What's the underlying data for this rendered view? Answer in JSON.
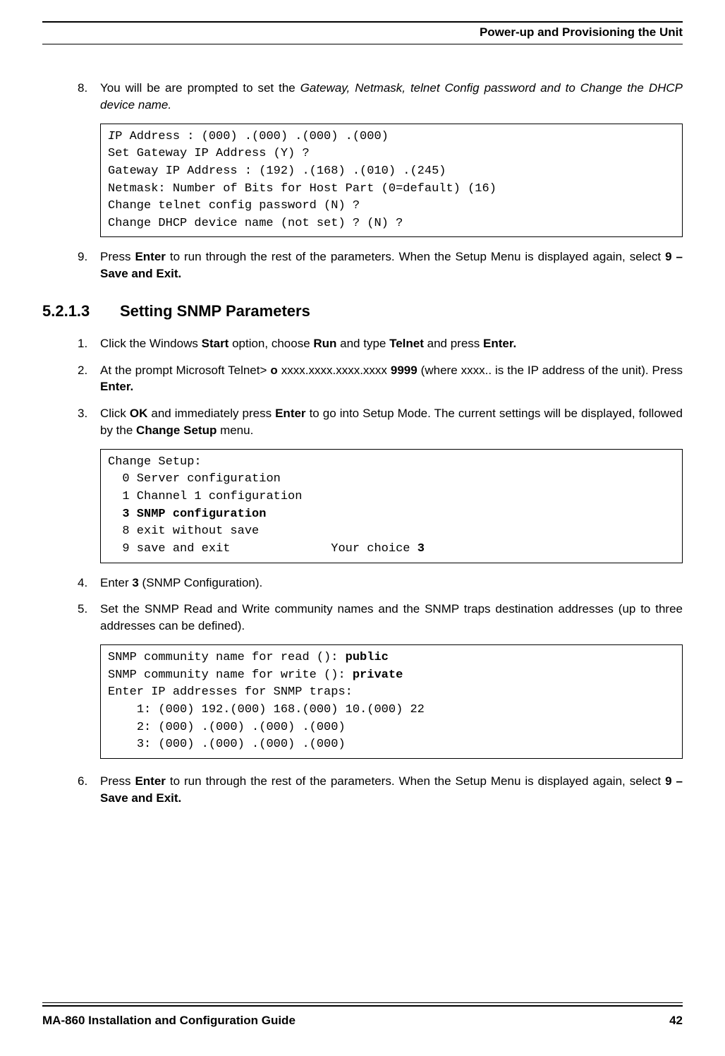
{
  "header": {
    "title": "Power-up and Provisioning the Unit"
  },
  "step8": {
    "num": "8.",
    "prefix": "You will be are prompted to set the ",
    "italic": "Gateway, Netmask, telnet Config password and to Change the DHCP device name.",
    "code": {
      "l1a": "I",
      "l1b": "P Address : (000) .(000) .(000) .(000)",
      "l2": "Set Gateway IP Address (Y) ?",
      "l3": "Gateway IP Address : (192) .(168) .(010) .(245)",
      "l4": "Netmask: Number of Bits for Host Part (0=default) (16)",
      "l5": "Change telnet config password (N) ?",
      "l6": "Change DHCP device name (not set) ? (N) ?"
    }
  },
  "step9": {
    "num": "9.",
    "t1": "Press ",
    "b1": "Enter",
    "t2": " to run through the rest of the parameters. When the Setup Menu is displayed again, select ",
    "b2": "9 – Save and Exit."
  },
  "section": {
    "num": "5.2.1.3",
    "title": "Setting SNMP Parameters"
  },
  "s1": {
    "num": "1.",
    "t1": "Click the Windows ",
    "b1": "Start",
    "t2": " option, choose ",
    "b2": "Run",
    "t3": " and type ",
    "b3": "Telnet",
    "t4": " and press ",
    "b4": "Enter."
  },
  "s2": {
    "num": "2.",
    "t1": "At the prompt Microsoft Telnet> ",
    "b1": "o",
    "t2": " xxxx.xxxx.xxxx.xxxx ",
    "b2": "9999",
    "t3": " (where xxxx.. is the IP address of the unit). Press ",
    "b3": "Enter."
  },
  "s3": {
    "num": "3.",
    "t1": "Click ",
    "b1": "OK",
    "t2": " and immediately press ",
    "b2": "Enter",
    "t3": " to go into Setup Mode. The current settings will be displayed, followed by the ",
    "b3": "Change Setup",
    "t4": " menu.",
    "code": {
      "l1": "Change Setup:",
      "l2": "  0 Server configuration",
      "l3": "  1 Channel 1 configuration",
      "l4": "  3 SNMP configuration",
      "l5": "  8 exit without save",
      "l6a": "  9 save and exit              Your choice ",
      "l6b": "3"
    }
  },
  "s4": {
    "num": "4.",
    "t1": "Enter ",
    "b1": "3",
    "t2": " (SNMP Configuration)."
  },
  "s5": {
    "num": "5.",
    "t1": "Set the SNMP Read and Write community names and the SNMP traps destination addresses (up to three addresses can be defined).",
    "code": {
      "l1a": "SNMP community name for read (): ",
      "l1b": "public",
      "l2a": "SNMP community name for write (): ",
      "l2b": "private",
      "l3": "Enter IP addresses for SNMP traps:",
      "l4": "    1: (000) 192.(000) 168.(000) 10.(000) 22",
      "l5": "    2: (000) .(000) .(000) .(000)",
      "l6": "    3: (000) .(000) .(000) .(000)"
    }
  },
  "s6": {
    "num": "6.",
    "t1": "Press ",
    "b1": "Enter",
    "t2": " to run through the rest of the parameters. When the Setup Menu is displayed again, select ",
    "b2": "9 – Save and Exit."
  },
  "footer": {
    "left": "MA-860 Installation and Configuration Guide",
    "right": "42"
  }
}
